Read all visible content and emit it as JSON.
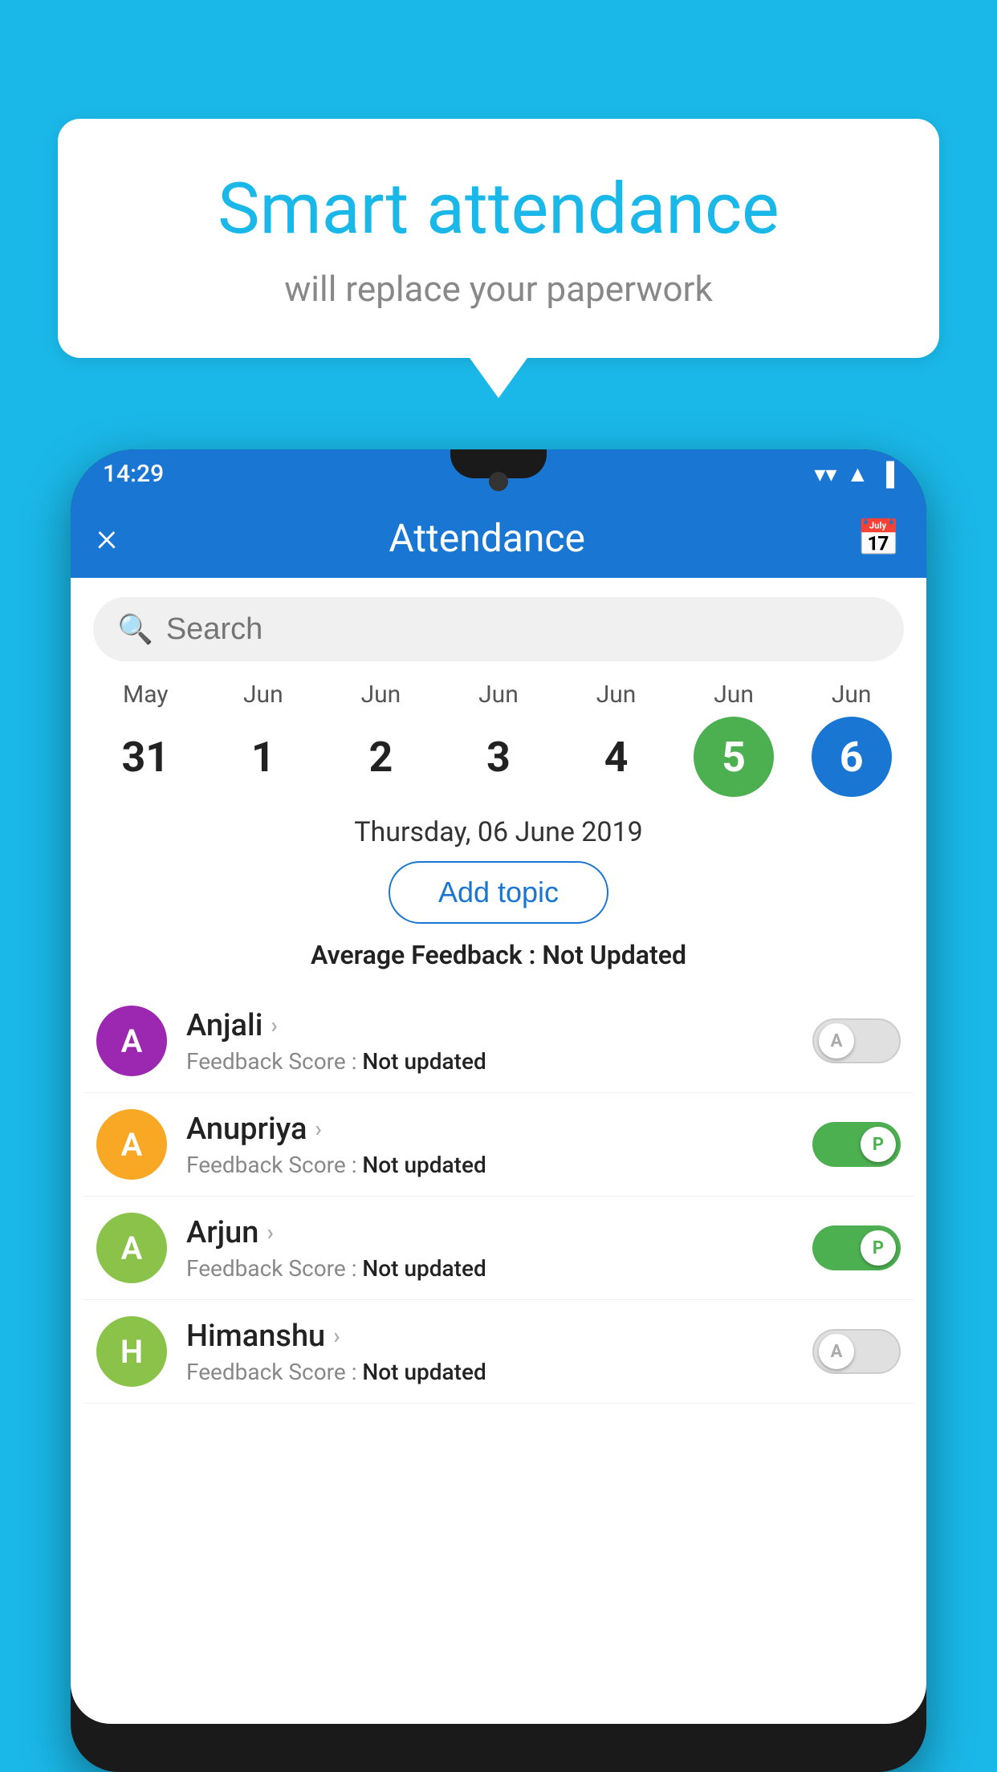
{
  "background_color": "#1ab8e8",
  "speech_bubble": {
    "title": "Smart attendance",
    "subtitle": "will replace your paperwork"
  },
  "status_bar": {
    "time": "14:29",
    "wifi": "▲",
    "signal": "▲",
    "battery": "▌"
  },
  "app_bar": {
    "title": "Attendance",
    "close_label": "×",
    "calendar_icon": "📅"
  },
  "search": {
    "placeholder": "Search"
  },
  "calendar": {
    "days": [
      {
        "month": "May",
        "day": "31",
        "state": "normal"
      },
      {
        "month": "Jun",
        "day": "1",
        "state": "normal"
      },
      {
        "month": "Jun",
        "day": "2",
        "state": "normal"
      },
      {
        "month": "Jun",
        "day": "3",
        "state": "normal"
      },
      {
        "month": "Jun",
        "day": "4",
        "state": "normal"
      },
      {
        "month": "Jun",
        "day": "5",
        "state": "today"
      },
      {
        "month": "Jun",
        "day": "6",
        "state": "selected"
      }
    ]
  },
  "selected_date": "Thursday, 06 June 2019",
  "add_topic_label": "Add topic",
  "feedback_summary": {
    "label": "Average Feedback : ",
    "value": "Not Updated"
  },
  "students": [
    {
      "name": "Anjali",
      "feedback_label": "Feedback Score : ",
      "feedback_value": "Not updated",
      "avatar_letter": "A",
      "avatar_color": "#9c27b0",
      "toggle_state": "off",
      "toggle_label": "A"
    },
    {
      "name": "Anupriya",
      "feedback_label": "Feedback Score : ",
      "feedback_value": "Not updated",
      "avatar_letter": "A",
      "avatar_color": "#f9a825",
      "toggle_state": "on",
      "toggle_label": "P"
    },
    {
      "name": "Arjun",
      "feedback_label": "Feedback Score : ",
      "feedback_value": "Not updated",
      "avatar_letter": "A",
      "avatar_color": "#8bc34a",
      "toggle_state": "on",
      "toggle_label": "P"
    },
    {
      "name": "Himanshu",
      "feedback_label": "Feedback Score : ",
      "feedback_value": "Not updated",
      "avatar_letter": "H",
      "avatar_color": "#8bc34a",
      "toggle_state": "off",
      "toggle_label": "A"
    }
  ]
}
